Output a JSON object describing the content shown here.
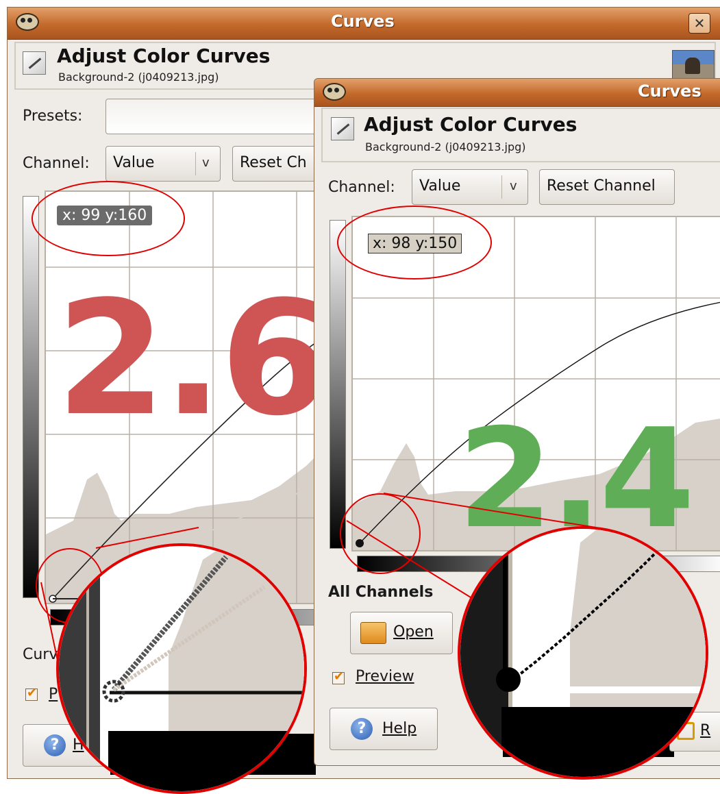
{
  "back_window": {
    "title": "Curves",
    "close_symbol": "✕",
    "header_title": "Adjust Color Curves",
    "header_subtitle": "Background-2 (j0409213.jpg)",
    "presets_label": "Presets:",
    "channel_label": "Channel:",
    "channel_value": "Value",
    "dropdown_arrow": "v",
    "reset_label": "Reset Ch",
    "readout": "x: 99 y:160",
    "curve_label": "Curv",
    "preview_label": "P",
    "help_label": "H"
  },
  "front_window": {
    "title": "Curves",
    "header_title": "Adjust Color Curves",
    "header_subtitle": "Background-2 (j0409213.jpg)",
    "channel_label": "Channel:",
    "channel_value": "Value",
    "dropdown_arrow": "v",
    "reset_label": "Reset Channel",
    "readout": "x: 98 y:150",
    "all_channels_label": "All Channels",
    "open_label": "Open",
    "preview_label": "Preview",
    "preview_checked": true,
    "help_label": "Help",
    "help_icon_symbol": "?",
    "reset_partial": "R"
  },
  "versions": {
    "back": "2.6",
    "front": "2.4",
    "back_color": "#cf5555",
    "front_color": "#5fae57"
  },
  "colors": {
    "annotation": "#e00000",
    "titlebar": "#c3692b",
    "histogram": "#d8d1ca",
    "window_bg": "#efebe7"
  }
}
